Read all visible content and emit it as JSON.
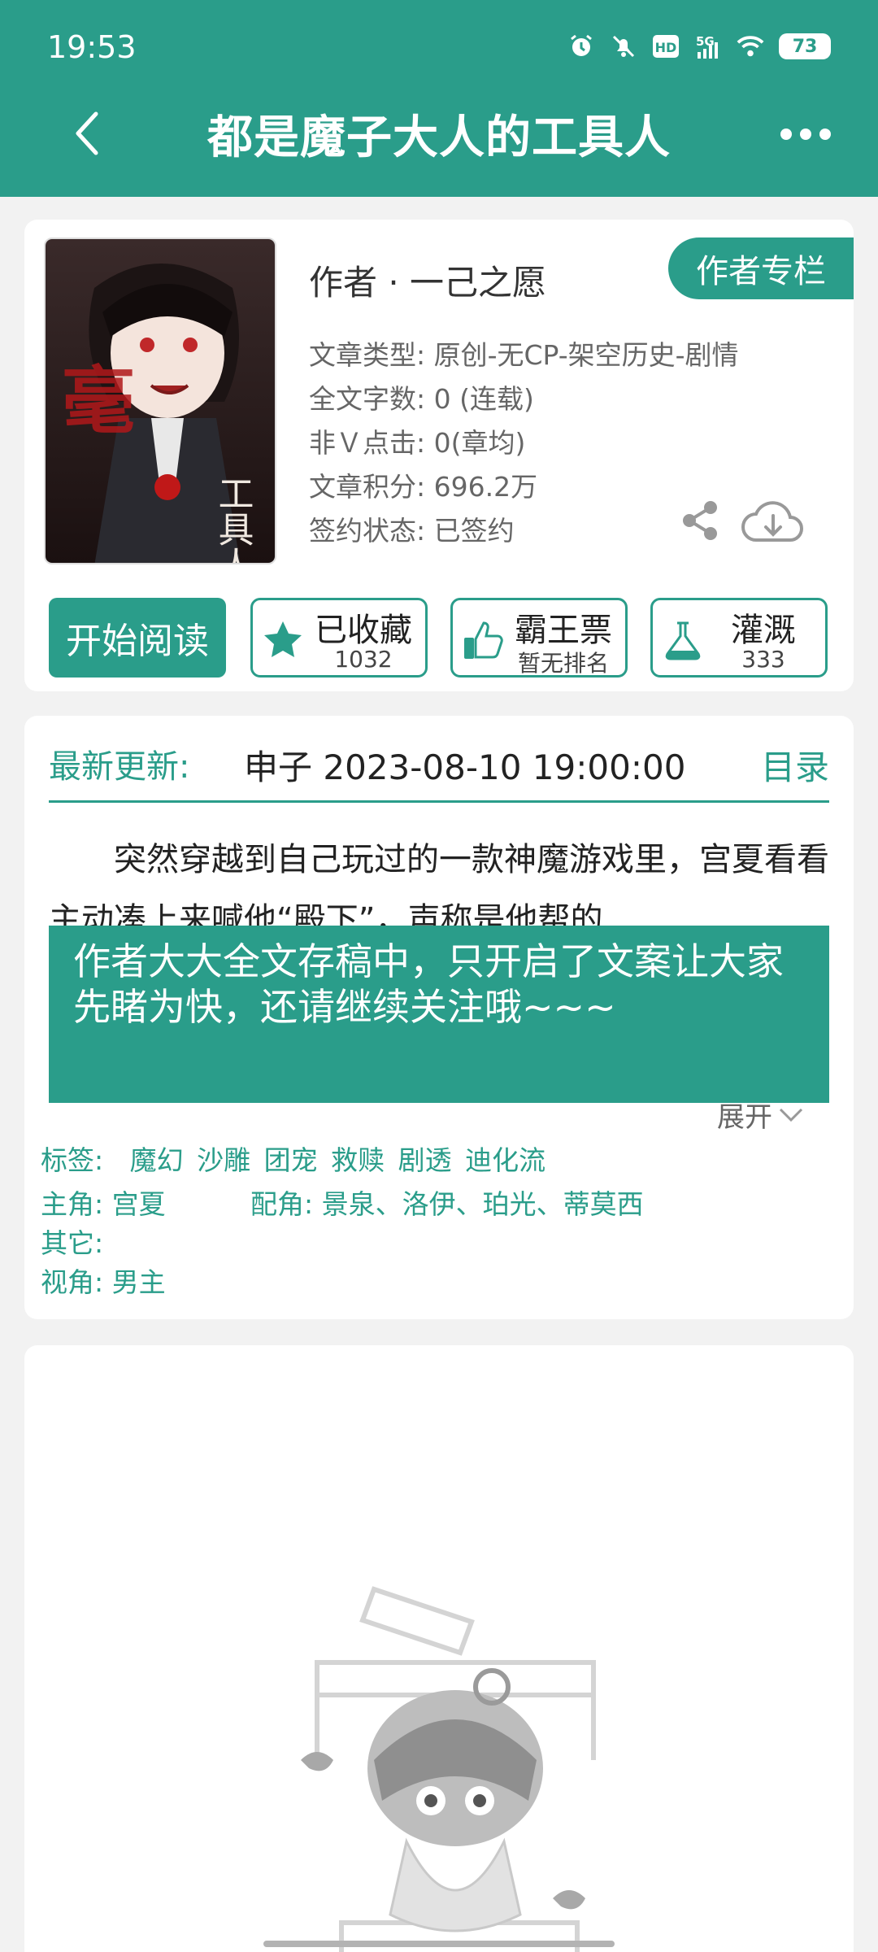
{
  "status_bar": {
    "time": "19:53",
    "battery": "73",
    "icons": [
      "alarm-icon",
      "mute-icon",
      "hd-icon",
      "5g-icon",
      "wifi-icon"
    ]
  },
  "nav": {
    "title": "都是魔子大人的工具人",
    "back_icon": "chevron-left-icon",
    "more_icon": "more-dots-icon"
  },
  "book": {
    "author": "作者 · 一己之愿",
    "author_column_label": "作者专栏",
    "meta": [
      "文章类型: 原创-无CP-架空历史-剧情",
      "全文字数: 0 (连载)",
      "非Ｖ点击: 0(章均)",
      "文章积分: 696.2万",
      "签约状态: 已签约"
    ],
    "actions": {
      "read_label": "开始阅读",
      "collect_label": "已收藏",
      "collect_count": "1032",
      "bawang_label": "霸王票",
      "bawang_value": "暂无排名",
      "irrigate_label": "灌溉",
      "irrigate_count": "333"
    }
  },
  "latest": {
    "label": "最新更新:",
    "text": "申子  2023-08-10 19:00:00",
    "catalog_label": "目录"
  },
  "synopsis": {
    "text": "突然穿越到自己玩过的一款神魔游戏里，宫夏看看主动凑上来喊他“殿下”，声称是他帮的",
    "notice": "作者大大全文存稿中，只开启了文案让大家先睹为快，还请继续关注哦~~~",
    "expand_label": "展开"
  },
  "info": {
    "tags_label": "标签:",
    "tags": [
      "魔幻",
      "沙雕",
      "团宠",
      "救赎",
      "剧透",
      "迪化流"
    ],
    "protagonist_label": "主角:",
    "protagonist": "宫夏",
    "supporting_label": "配角:",
    "supporting": "景泉、洛伊、珀光、蒂莫西",
    "other_label": "其它:",
    "other": "",
    "perspective_label": "视角:",
    "perspective": "男主"
  },
  "colors": {
    "primary": "#2a9d8a",
    "background": "#f2f2f2",
    "card": "#ffffff"
  }
}
